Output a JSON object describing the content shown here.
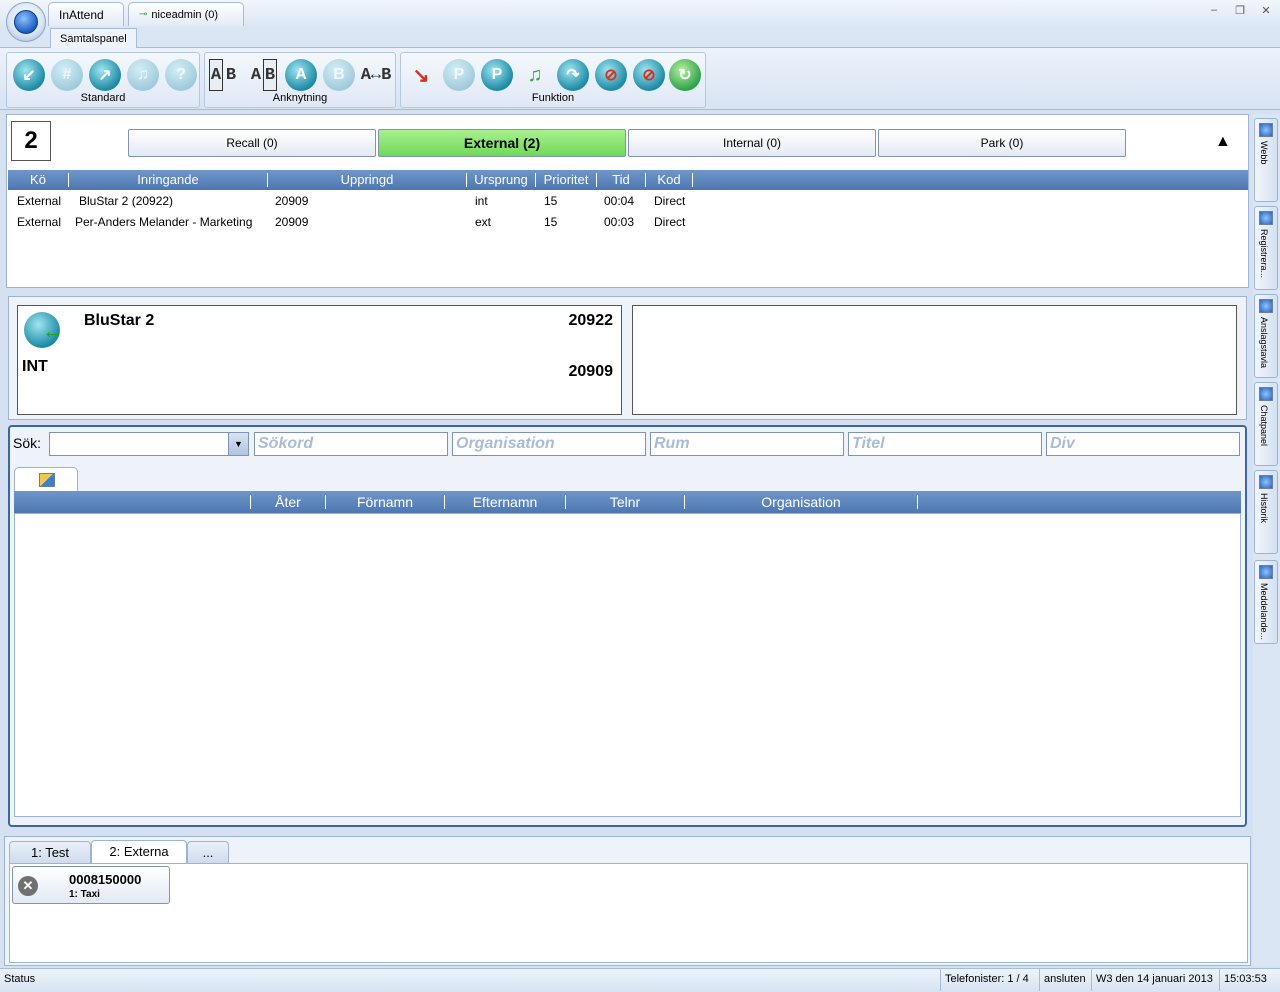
{
  "window": {
    "app_tab": "InAttend",
    "user_tab": "niceadmin (0)",
    "controls": [
      "–",
      "❐",
      "✕"
    ],
    "ribbon_tab": "Samtalspanel"
  },
  "ribbon": {
    "groups": [
      {
        "label": "Standard"
      },
      {
        "label": "Anknytning"
      },
      {
        "label": "Funktion"
      }
    ]
  },
  "queue": {
    "count": "2",
    "tabs": [
      {
        "label": "Recall (0)",
        "active": false
      },
      {
        "label": "External (2)",
        "active": true
      },
      {
        "label": "Internal (0)",
        "active": false
      },
      {
        "label": "Park (0)",
        "active": false
      }
    ],
    "columns": [
      "Kö",
      "Inringande",
      "Uppringd",
      "Ursprung",
      "Prioritet",
      "Tid",
      "Kod"
    ],
    "rows": [
      {
        "ko": "External",
        "inringande": "BluStar 2 (20922)",
        "uppringd": "20909",
        "ursprung": "int",
        "prioritet": "15",
        "tid": "00:04",
        "kod": "Direct"
      },
      {
        "ko": "External",
        "inringande": "Per-Anders Melander - Marketing",
        "uppringd": "20909",
        "ursprung": "ext",
        "prioritet": "15",
        "tid": "00:03",
        "kod": "Direct"
      }
    ]
  },
  "call": {
    "name": "BluStar 2",
    "number": "20922",
    "type": "INT",
    "called": "20909"
  },
  "search": {
    "label": "Sök:",
    "fields": [
      "Sökord",
      "Organisation",
      "Rum",
      "Titel",
      "Div"
    ],
    "columns": [
      "Åter",
      "Förnamn",
      "Efternamn",
      "Telnr",
      "Organisation"
    ]
  },
  "bottom": {
    "tabs": [
      {
        "label": "1: Test",
        "active": false
      },
      {
        "label": "2: Externa",
        "active": true
      },
      {
        "label": "...",
        "active": false
      }
    ],
    "card": {
      "number": "0008150000",
      "sub": "1: Taxi"
    }
  },
  "sidebar": [
    "Webb",
    "Registrera...",
    "Anslagstavla",
    "Chatpanel",
    "Historik",
    "Meddelande..."
  ],
  "status": {
    "left": "Status",
    "telefonister": "Telefonister: 1 / 4",
    "state": "ansluten",
    "date": "W3 den 14 januari 2013",
    "time": "15:03:53"
  },
  "colors": {
    "accent": "#4d77b2",
    "active_tab": "#6fd957",
    "placeholder": "#a8bcd8"
  }
}
